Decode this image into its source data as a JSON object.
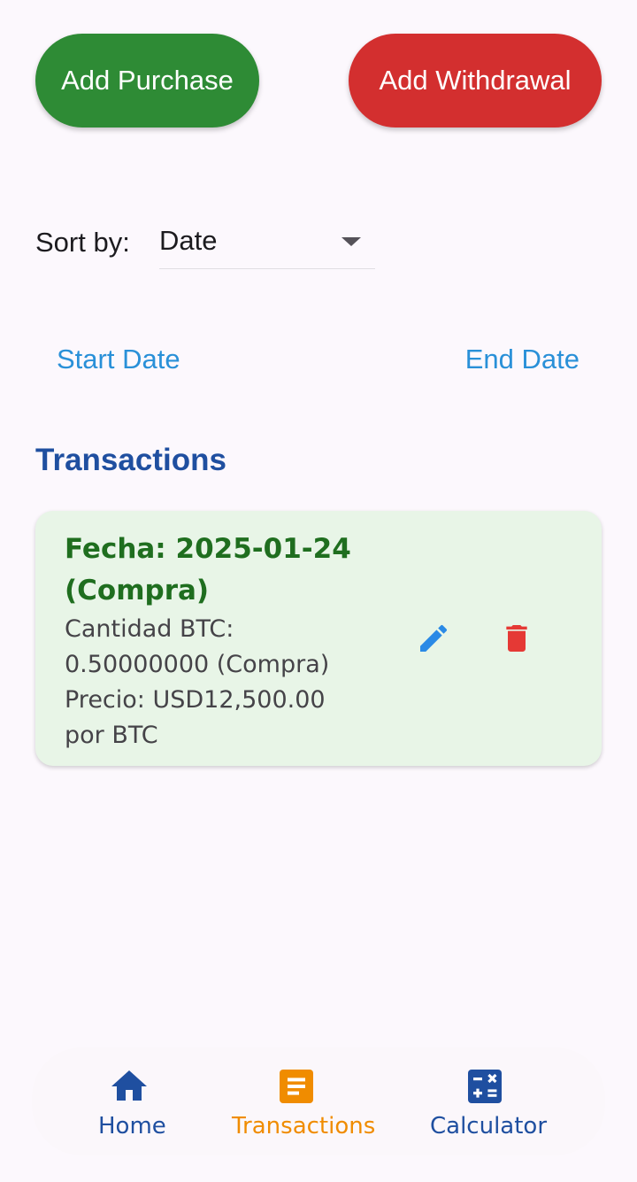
{
  "actions": {
    "add_purchase_label": "Add Purchase",
    "add_withdrawal_label": "Add Withdrawal",
    "purchase_color": "#2e8b35",
    "withdrawal_color": "#d32f2f"
  },
  "sort": {
    "label": "Sort by:",
    "selected": "Date"
  },
  "filters": {
    "start_date": "Start Date",
    "end_date": "End Date"
  },
  "transactions": {
    "title": "Transactions",
    "items": [
      {
        "title_line1": "Fecha: 2025-01-24",
        "title_line2": "(Compra)",
        "details": [
          "Cantidad BTC:",
          "0.50000000 (Compra)",
          "Precio: USD12,500.00",
          "por BTC"
        ],
        "edit_icon": "pencil-icon",
        "delete_icon": "trash-icon"
      }
    ]
  },
  "nav": {
    "items": [
      {
        "label": "Home",
        "icon": "home-icon"
      },
      {
        "label": "Transactions",
        "icon": "document-icon"
      },
      {
        "label": "Calculator",
        "icon": "calculator-icon"
      }
    ],
    "active": "Transactions",
    "active_color": "#f08c00",
    "inactive_color": "#1f4fa0"
  }
}
